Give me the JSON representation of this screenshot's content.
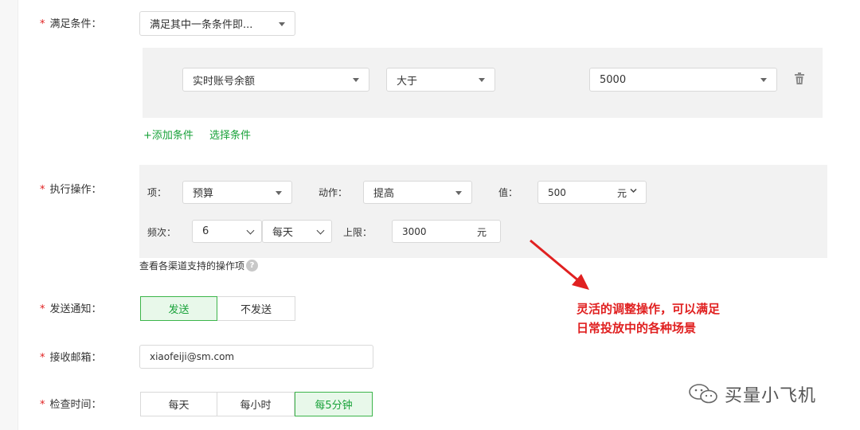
{
  "form": {
    "condition": {
      "label": "满足条件：",
      "required_mark": "*",
      "match_select": "满足其中一条条件即...",
      "rule": {
        "metric": "实时账号余额",
        "operator": "大于",
        "value": "5000"
      },
      "add_condition": "+添加条件",
      "choose_condition": "选择条件"
    },
    "action": {
      "label": "执行操作：",
      "required_mark": "*",
      "item_label": "项：",
      "item_value": "预算",
      "action_label": "动作：",
      "action_value": "提高",
      "value_label": "值：",
      "value_amount": "500",
      "value_unit": "元",
      "freq_label": "频次：",
      "freq_count": "6",
      "freq_period": "每天",
      "limit_label": "上限：",
      "limit_amount": "3000",
      "limit_unit": "元",
      "help_text": "查看各渠道支持的操作项",
      "help_icon_glyph": "?"
    },
    "notify": {
      "label": "发送通知：",
      "required_mark": "*",
      "options": [
        "发送",
        "不发送"
      ],
      "selected": "发送"
    },
    "email": {
      "label": "接收邮箱：",
      "required_mark": "*",
      "value": "xiaofeiji@sm.com"
    },
    "check_time": {
      "label": "检查时间：",
      "required_mark": "*",
      "options": [
        "每天",
        "每小时",
        "每5分钟"
      ],
      "selected": "每5分钟"
    }
  },
  "annotation": {
    "line1": "灵活的调整操作，可以满足",
    "line2": "日常投放中的各种场景",
    "color": "#e02020"
  },
  "watermark": {
    "text": "买量小飞机"
  },
  "colors": {
    "accent_green": "#19a23a",
    "panel_gray": "#f2f2f2",
    "required_red": "#e02020"
  }
}
